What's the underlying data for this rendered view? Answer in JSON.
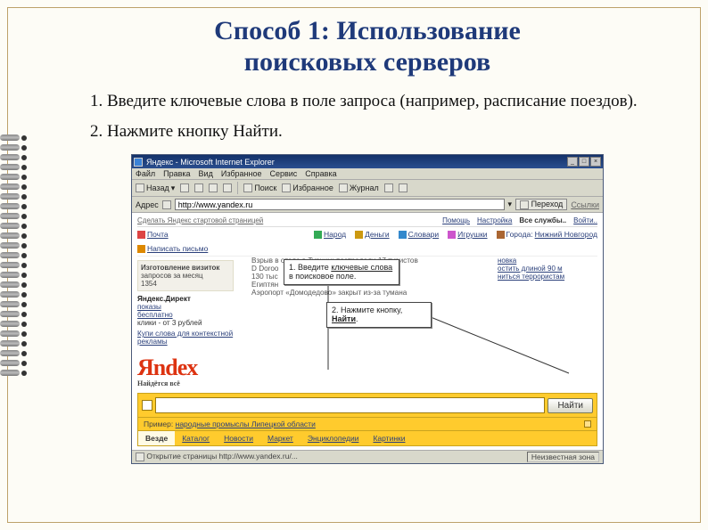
{
  "title_line1": "Способ 1: Использование",
  "title_line2": "поисковых серверов",
  "steps": [
    "Введите ключевые слова в поле запроса (например, расписание поездов).",
    "Нажмите кнопку Найти."
  ],
  "browser": {
    "title": "Яндекс - Microsoft Internet Explorer",
    "menu": [
      "Файл",
      "Правка",
      "Вид",
      "Избранное",
      "Сервис",
      "Справка"
    ],
    "toolbar": {
      "back": "Назад",
      "search": "Поиск",
      "fav": "Избранное",
      "journal": "Журнал"
    },
    "addr_label": "Адрес",
    "addr_url": "http://www.yandex.ru",
    "go": "Переход",
    "links": "Ссылки"
  },
  "yandex": {
    "top_left": "Сделать Яндекс стартовой страницей",
    "top_right": [
      "Помощь",
      "Настройка",
      "Все службы..",
      "Войти.."
    ],
    "row1": [
      "Почта",
      "Народ",
      "Деньги",
      "Словари",
      "Игрушки"
    ],
    "row1_city_label": "Города:",
    "row1_city": "Нижний Новгород",
    "row2": "Написать письмо",
    "offer_title": "Изготовление визиток",
    "offer_sub": "запросов за месяц",
    "offer_num": "1354",
    "direct": {
      "title": "Яндекс.Директ",
      "line1": "показы",
      "line2": "бесплатно",
      "line3": "клики - от 3 рублей",
      "line4": "Купи слова для контекстной рекламы"
    },
    "news": [
      "Взрыв в отеле в Турции: пострадали 17 туристов",
      "D Doroо",
      "130 тыс",
      "Египтян",
      "Аэропорт «Домодедово» закрыт из-за тумана"
    ],
    "rcol": [
      "новка",
      "остить длиной 90 м",
      "ниться террористам"
    ],
    "logo": "Яndex",
    "logo_sub": "Найдётся всё",
    "eg_label": "Пример:",
    "eg_text": "народные промыслы Липецкой области",
    "tabs": [
      "Везде",
      "Каталог",
      "Новости",
      "Маркет",
      "Энциклопедии",
      "Картинки"
    ],
    "naiti": "Найти"
  },
  "callouts": {
    "c1_a": "1. Введите ",
    "c1_b": "ключевые слова",
    "c1_c": " в поисковое поле.",
    "c2_a": "2. Нажмите кнопку, ",
    "c2_b": "Найти",
    "c2_c": "."
  },
  "status": {
    "left": "Открытие страницы http://www.yandex.ru/...",
    "right": "Неизвестная зона"
  }
}
